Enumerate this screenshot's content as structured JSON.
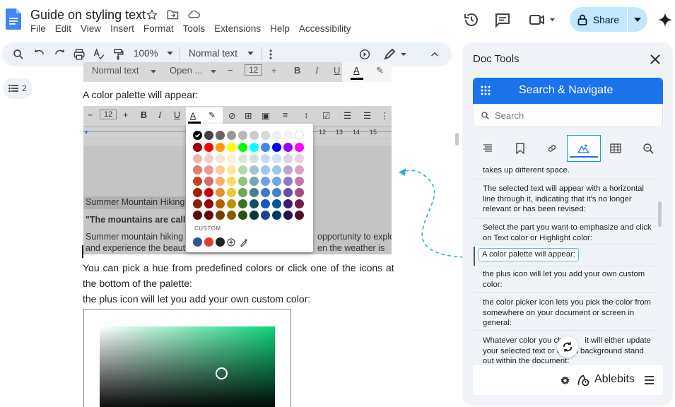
{
  "document": {
    "title": "Guide on styling text",
    "menu": [
      "File",
      "Edit",
      "View",
      "Insert",
      "Format",
      "Tools",
      "Extensions",
      "Help",
      "Accessibility"
    ]
  },
  "header": {
    "share_label": "Share"
  },
  "toolbar": {
    "zoom": "100%",
    "style": "Normal text"
  },
  "outline": {
    "count": "2"
  },
  "doc_body": {
    "shot1": {
      "style": "Normal text",
      "font": "Open ...",
      "size": "12"
    },
    "para1": "A color palette will appear:",
    "shot2": {
      "size": "12",
      "line1": "Summer Mountain Hiking",
      "line2": "\"The mountains are calli",
      "line3a": "Summer mountain hiking",
      "line3b": "opportunity to explore",
      "line4a": "and experience the beaut",
      "line4b": "en the weather is",
      "custom_label": "CUSTOM"
    },
    "para2a": "You can pick a hue from predefined colors or click one of the icons at",
    "para2b": "the bottom of the palette:",
    "para3": "the plus icon will let you add your own custom color:"
  },
  "palette_colors": {
    "row0": [
      "#000000",
      "#434343",
      "#666666",
      "#999999",
      "#b7b7b7",
      "#cccccc",
      "#d9d9d9",
      "#efefef",
      "#f3f3f3",
      "#ffffff"
    ],
    "row1": [
      "#980000",
      "#ff0000",
      "#ff9900",
      "#ffff00",
      "#00ff00",
      "#00ffff",
      "#4a86e8",
      "#0000ff",
      "#9900ff",
      "#ff00ff"
    ],
    "row2": [
      "#e6b8af",
      "#f4cccc",
      "#fce5cd",
      "#fff2cc",
      "#d9ead3",
      "#d0e0e3",
      "#c9daf8",
      "#cfe2f3",
      "#d9d2e9",
      "#ead1dc"
    ],
    "row3": [
      "#dd7e6b",
      "#ea9999",
      "#f9cb9c",
      "#ffe599",
      "#b6d7a8",
      "#a2c4c9",
      "#a4c2f4",
      "#9fc5e8",
      "#b4a7d6",
      "#d5a6bd"
    ],
    "row4": [
      "#cc4125",
      "#e06666",
      "#f6b26b",
      "#ffd966",
      "#93c47d",
      "#76a5af",
      "#6d9eeb",
      "#6fa8dc",
      "#8e7cc3",
      "#c27ba0"
    ],
    "row5": [
      "#a61c00",
      "#cc0000",
      "#e69138",
      "#f1c232",
      "#6aa84f",
      "#45818e",
      "#3c78d8",
      "#3d85c6",
      "#674ea7",
      "#a64d79"
    ],
    "row6": [
      "#85200c",
      "#990000",
      "#b45f06",
      "#bf9000",
      "#38761d",
      "#134f5c",
      "#1155cc",
      "#0b5394",
      "#351c75",
      "#741b47"
    ],
    "row7": [
      "#5b0f00",
      "#660000",
      "#783f04",
      "#7f6000",
      "#274e13",
      "#0c343d",
      "#1c4587",
      "#073763",
      "#20124d",
      "#4c1130"
    ],
    "custom": [
      "#2f5597",
      "#e53935",
      "#222222"
    ]
  },
  "panel": {
    "title": "Doc Tools",
    "section": "Search & Navigate",
    "search_placeholder": "Search",
    "items": [
      "takes up different space.",
      "The selected text will appear with a horizontal line through it, indicating that it's no longer relevant or has been revised:",
      "Select the part you want to emphasize and click on Text color or Highlight color:",
      "A color palette will appear:",
      "the plus icon will let you add your own custom color:",
      "the color picker icon lets you pick the color from somewhere on your document or screen in general:",
      "Whatever color you ch",
      "it will either update",
      "your selected text or n",
      "s background stand",
      "out within the document:"
    ],
    "brand": "Ablebits"
  }
}
